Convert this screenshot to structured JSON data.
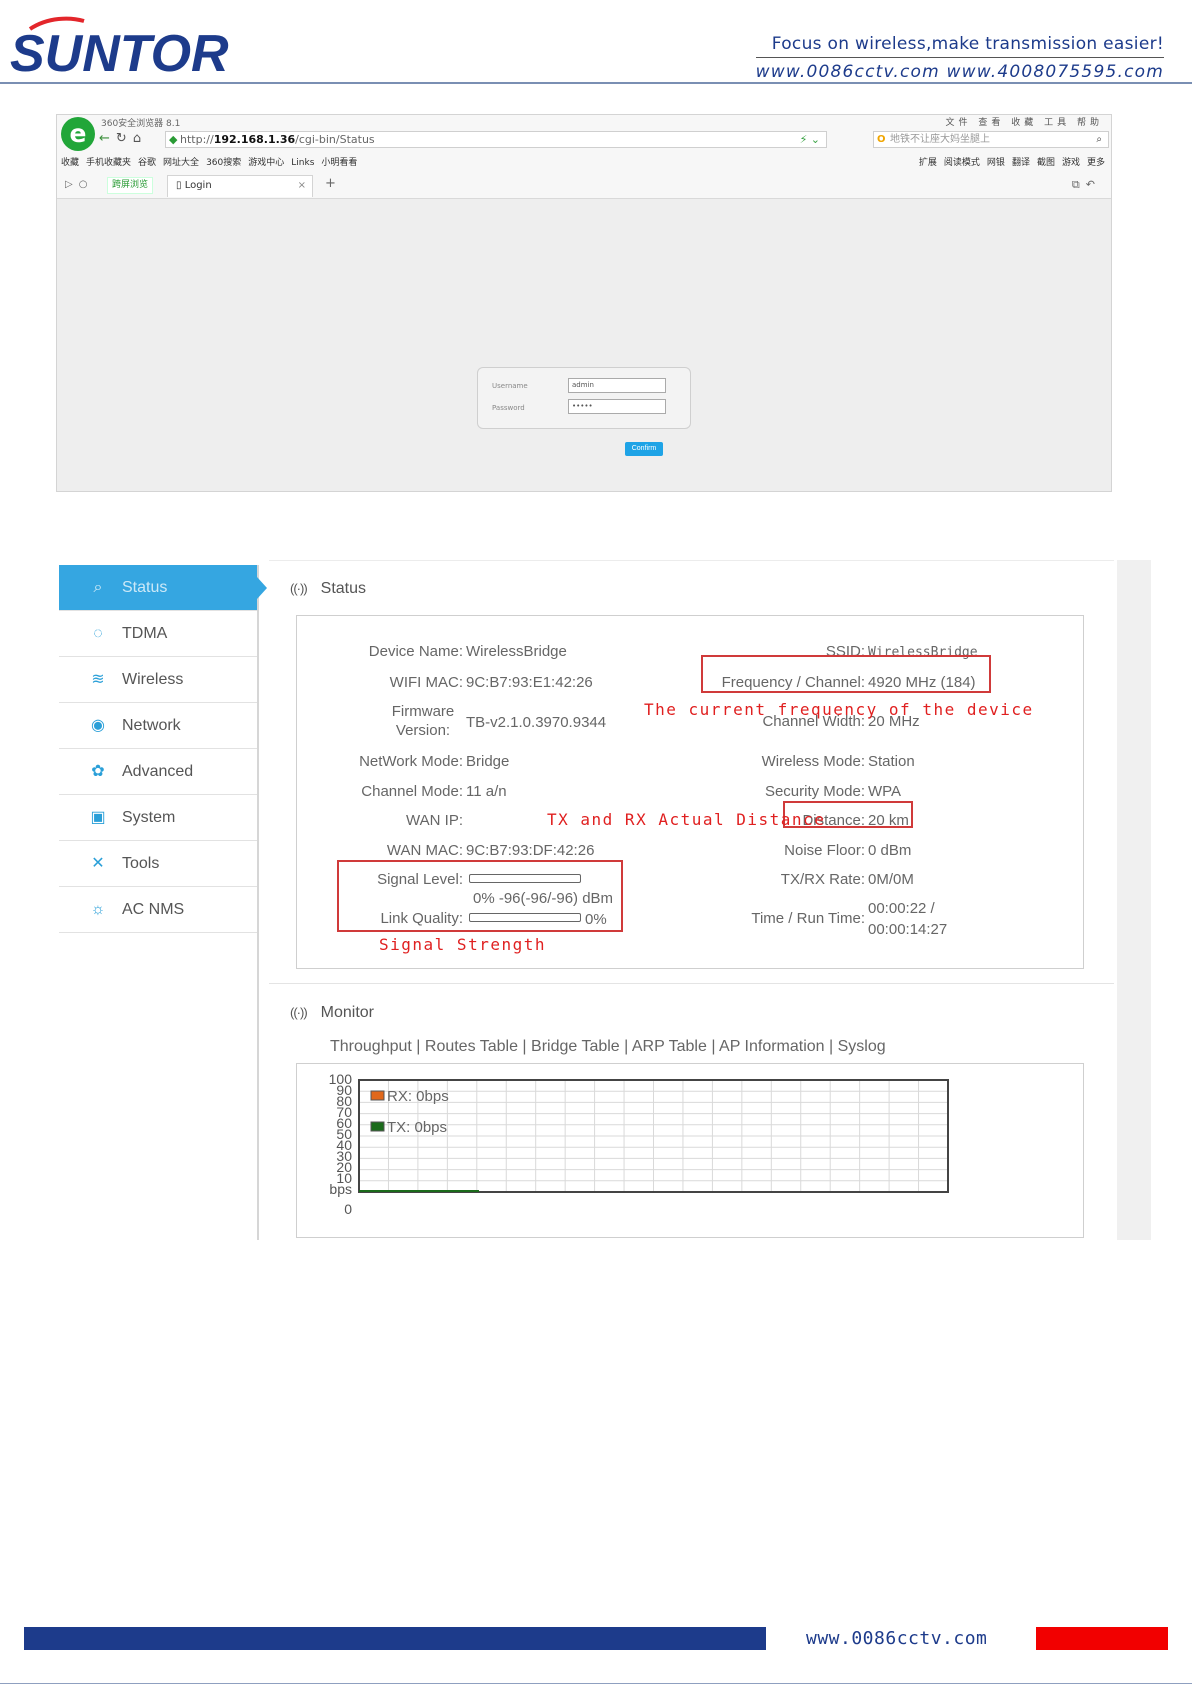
{
  "header": {
    "logo_text": "SUNTOR",
    "tagline": "Focus on wireless,make transmission easier!",
    "websites": "www.0086cctv.com  www.4008075595.com"
  },
  "browser": {
    "title": "360安全浏览器 8.1",
    "window_buttons": "文件 查看 收藏 工具 帮助",
    "url_prefix": "http://",
    "url_host": "192.168.1.36",
    "url_path": "/cgi-bin/Status",
    "search_placeholder": "地铁不让座大妈坐腿上",
    "favorites": [
      "收藏",
      "手机收藏夹",
      "谷歌",
      "网址大全",
      "360搜索",
      "游戏中心",
      "Links",
      "小明看看"
    ],
    "toolbar_right": [
      "扩展",
      "阅读模式",
      "网银",
      "翻译",
      "截图",
      "游戏",
      "更多"
    ],
    "green_tab": "跨屏浏览",
    "tab_title": "Login",
    "login": {
      "username_label": "Username",
      "username_value": "admin",
      "password_label": "Password",
      "password_value": "•••••",
      "confirm_label": "Confirm"
    }
  },
  "router": {
    "sidebar": [
      {
        "label": "Status",
        "icon": "status-icon"
      },
      {
        "label": "TDMA",
        "icon": "tdma-icon"
      },
      {
        "label": "Wireless",
        "icon": "wifi-icon"
      },
      {
        "label": "Network",
        "icon": "network-icon"
      },
      {
        "label": "Advanced",
        "icon": "advanced-icon"
      },
      {
        "label": "System",
        "icon": "system-icon"
      },
      {
        "label": "Tools",
        "icon": "tools-icon"
      },
      {
        "label": "AC NMS",
        "icon": "ac-nms-icon"
      }
    ],
    "status_title": "Status",
    "monitor_title": "Monitor",
    "fields": {
      "device_name_label": "Device Name:",
      "device_name": "WirelessBridge",
      "wifi_mac_label": "WIFI MAC:",
      "wifi_mac": "9C:B7:93:E1:42:26",
      "firmware_label_1": "Firmware",
      "firmware_label_2": "Version:",
      "firmware": "TB-v2.1.0.3970.9344",
      "network_mode_label": "NetWork Mode:",
      "network_mode": "Bridge",
      "channel_mode_label": "Channel Mode:",
      "channel_mode": "11 a/n",
      "wan_ip_label": "WAN IP:",
      "wan_ip": "",
      "wan_mac_label": "WAN MAC:",
      "wan_mac": "9C:B7:93:DF:42:26",
      "signal_level_label": "Signal Level:",
      "signal_level": "0%   -96(-96/-96) dBm",
      "link_quality_label": "Link Quality:",
      "link_quality": "0%",
      "ssid_label": "SSID:",
      "ssid": "WirelessBridge",
      "freq_label": "Frequency / Channel:",
      "freq": "4920 MHz (184)",
      "channel_width_label": "Channel Width:",
      "channel_width": "20 MHz",
      "wireless_mode_label": "Wireless Mode:",
      "wireless_mode": "Station",
      "security_mode_label": "Security Mode:",
      "security_mode": "WPA",
      "distance_label": "Distance:",
      "distance": "20 km",
      "noise_floor_label": "Noise Floor:",
      "noise_floor": "0 dBm",
      "txrx_rate_label": "TX/RX Rate:",
      "txrx_rate": "0M/0M",
      "time_label": "Time / Run Time:",
      "time_1": "00:00:22 /",
      "time_2": "00:00:14:27"
    },
    "signal_level_fraction": 0,
    "link_quality_fraction": 0,
    "annotations": {
      "frequency": "The current frequency of the device",
      "distance": "TX and RX Actual Distance",
      "signal": "Signal Strength"
    },
    "monitor_links": "Throughput | Routes Table | Bridge Table | ARP Table | AP Information | Syslog",
    "colors": {
      "accent": "#35a6e1",
      "annotation": "#e02020",
      "rx": "#e0681c",
      "tx": "#1b6b1b"
    }
  },
  "chart_data": {
    "type": "line",
    "yticks": [
      "100",
      "90",
      "80",
      "70",
      "60",
      "50",
      "40",
      "30",
      "20",
      "10",
      "bps",
      "0"
    ],
    "ylim": [
      0,
      100
    ],
    "ylabel": "bps",
    "series": [
      {
        "name": "RX: 0bps",
        "values": [
          0,
          0,
          0,
          0,
          0
        ]
      },
      {
        "name": "TX: 0bps",
        "values": [
          0,
          0,
          0,
          0,
          0
        ]
      }
    ],
    "grid": true,
    "legend": "top-left"
  },
  "footer": {
    "url": "www.0086cctv.com",
    "colors": {
      "blue": "#1d3b8b",
      "red": "#f20000"
    }
  }
}
